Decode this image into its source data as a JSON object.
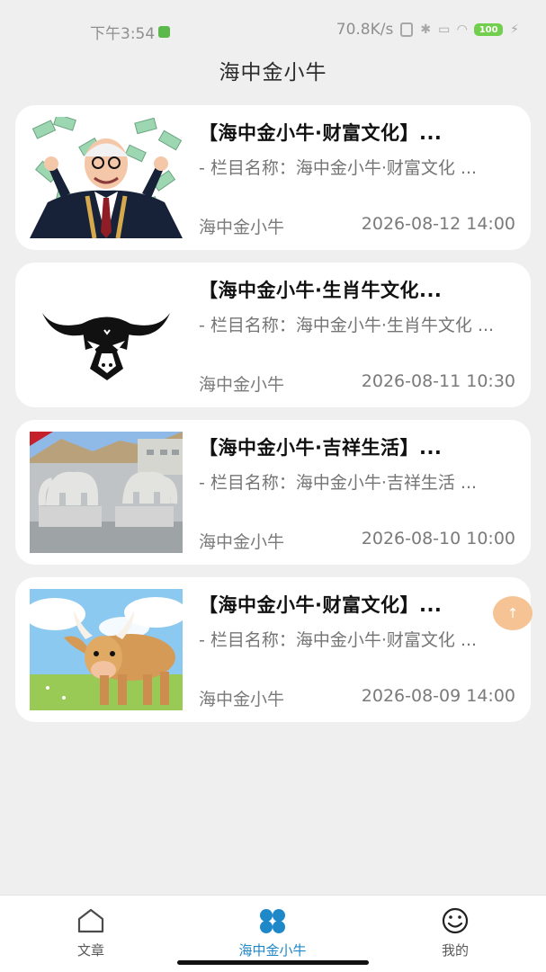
{
  "status_bar": {
    "time": "下午3:54",
    "speed": "70.8K/s",
    "battery": "100"
  },
  "page_title": "海中金小牛",
  "articles": [
    {
      "title": "【海中金小牛·财富文化】...",
      "desc": "- 栏目名称：海中金小牛·财富文化 ...",
      "author": "海中金小牛",
      "date": "2026-08-12 14:00",
      "image": "money-man"
    },
    {
      "title": "【海中金小牛·生肖牛文化...",
      "desc": "- 栏目名称：海中金小牛·生肖牛文化 ...",
      "author": "海中金小牛",
      "date": "2026-08-11 10:30",
      "image": "bull-logo"
    },
    {
      "title": "【海中金小牛·吉祥生活】...",
      "desc": "- 栏目名称：海中金小牛·吉祥生活 ...",
      "author": "海中金小牛",
      "date": "2026-08-10 10:00",
      "image": "stone-elephants"
    },
    {
      "title": "【海中金小牛·财富文化】...",
      "desc": "- 栏目名称：海中金小牛·财富文化 ...",
      "author": "海中金小牛",
      "date": "2026-08-09 14:00",
      "image": "cartoon-ox"
    }
  ],
  "nav": {
    "items": [
      {
        "label": "文章",
        "icon": "home-icon"
      },
      {
        "label": "海中金小牛",
        "icon": "grid-icon"
      },
      {
        "label": "我的",
        "icon": "smiley-icon"
      }
    ],
    "active_color": "#1f88c8"
  },
  "colors": {
    "background": "#efefef",
    "card": "#ffffff",
    "accent": "#1f88c8",
    "float_button": "#f5ba82"
  }
}
